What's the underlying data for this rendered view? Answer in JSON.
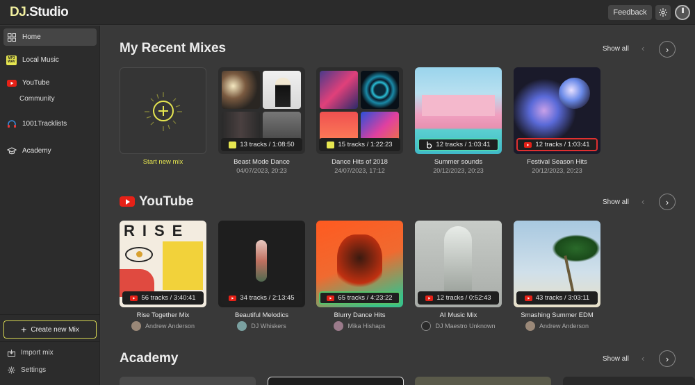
{
  "app": {
    "logo_prefix": "DJ",
    "logo_suffix": ".Studio",
    "feedback": "Feedback"
  },
  "sidebar": {
    "items": [
      {
        "label": "Home",
        "icon": "grid-icon"
      },
      {
        "label": "Local Music",
        "icon": "mp3-wav-icon",
        "icon_text": "MP3 WAV"
      },
      {
        "label": "YouTube",
        "icon": "youtube-icon"
      },
      {
        "label": "Community"
      },
      {
        "label": "1001Tracklists",
        "icon": "headphones-icon"
      },
      {
        "label": "Academy",
        "icon": "graduation-cap-icon"
      }
    ],
    "create_label": "Create new Mix",
    "import_label": "Import mix",
    "settings_label": "Settings"
  },
  "recent": {
    "title": "My Recent Mixes",
    "show_all": "Show all",
    "new_mix": "Start new mix",
    "cards": [
      {
        "title": "Beast Mode Dance",
        "date": "04/07/2023, 20:23",
        "tracks": "13 tracks / 1:08:50"
      },
      {
        "title": "Dance Hits of 2018",
        "date": "24/07/2023, 17:12",
        "tracks": "15 tracks / 1:22:23"
      },
      {
        "title": "Summer sounds",
        "date": "20/12/2023, 20:23",
        "tracks": "12 tracks / 1:03:41"
      },
      {
        "title": "Festival Season Hits",
        "date": "20/12/2023, 20:23",
        "tracks": "12 tracks / 1:03:41"
      }
    ]
  },
  "youtube": {
    "title": "YouTube",
    "show_all": "Show all",
    "cards": [
      {
        "title": "Rise Together Mix",
        "author": "Andrew Anderson",
        "tracks": "56 tracks / 3:40:41",
        "cover_text": "RISE"
      },
      {
        "title": "Beautiful Melodics",
        "author": "DJ Whiskers",
        "tracks": "34 tracks / 2:13:45"
      },
      {
        "title": "Blurry Dance Hits",
        "author": "Mika Hishaps",
        "tracks": "65 tracks / 4:23:22"
      },
      {
        "title": "AI Music Mix",
        "author": "DJ Maestro Unknown",
        "tracks": "12 tracks / 0:52:43"
      },
      {
        "title": "Smashing Summer EDM",
        "author": "Andrew Anderson",
        "tracks": "43 tracks / 3:03:11"
      }
    ]
  },
  "academy": {
    "title": "Academy",
    "show_all": "Show all"
  },
  "colors": {
    "accent": "#e6e650",
    "youtube_red": "#e62117",
    "teal": "#4ed6b8"
  }
}
